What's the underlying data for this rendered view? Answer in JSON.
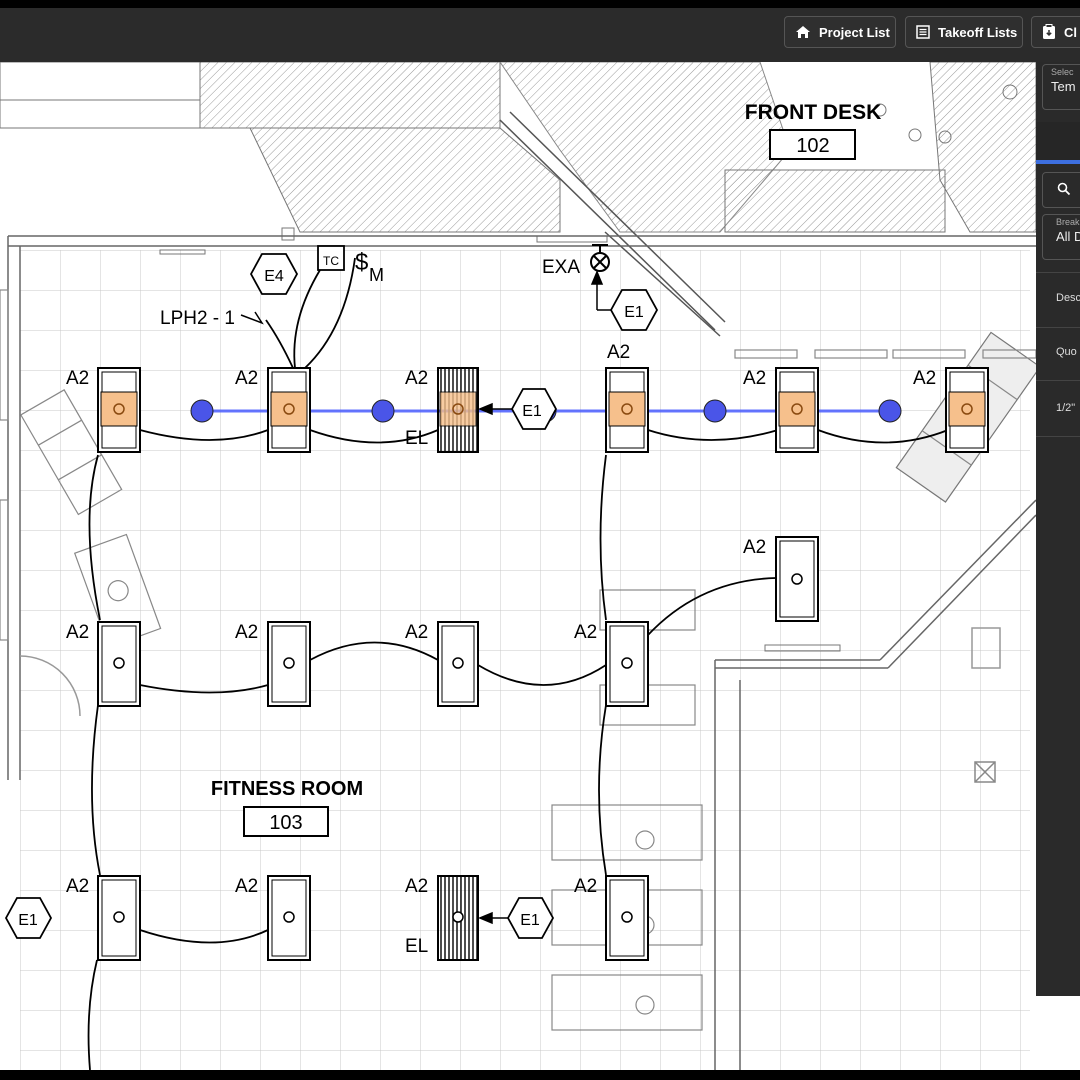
{
  "toolbar": {
    "project_list": "Project List",
    "takeoff_lists": "Takeoff Lists",
    "third_button_partial": "Cl"
  },
  "plan": {
    "rooms": [
      {
        "name": "FRONT DESK",
        "number": "102"
      },
      {
        "name": "FITNESS ROOM",
        "number": "103"
      }
    ],
    "fixture_label": "A2",
    "emergency_label": "EL",
    "exit_label": "EXA",
    "circuit_label": "LPH2 - 1",
    "tags": {
      "e1": "E1",
      "e4": "E4",
      "tc": "TC",
      "switch": "$",
      "switch_sub": "M"
    }
  },
  "panel": {
    "select_label": "Selec",
    "select_value": "Tem",
    "breakdown_label": "Break",
    "breakdown_value": "All D",
    "description_header": "Desc",
    "quantity_header": "Quo",
    "row_value": "1/2\""
  },
  "colors": {
    "topbar": "#2b2b2b",
    "panel": "#2a2a2a",
    "accent": "#4a5cff",
    "fixture_highlight": "#f6c08c"
  }
}
